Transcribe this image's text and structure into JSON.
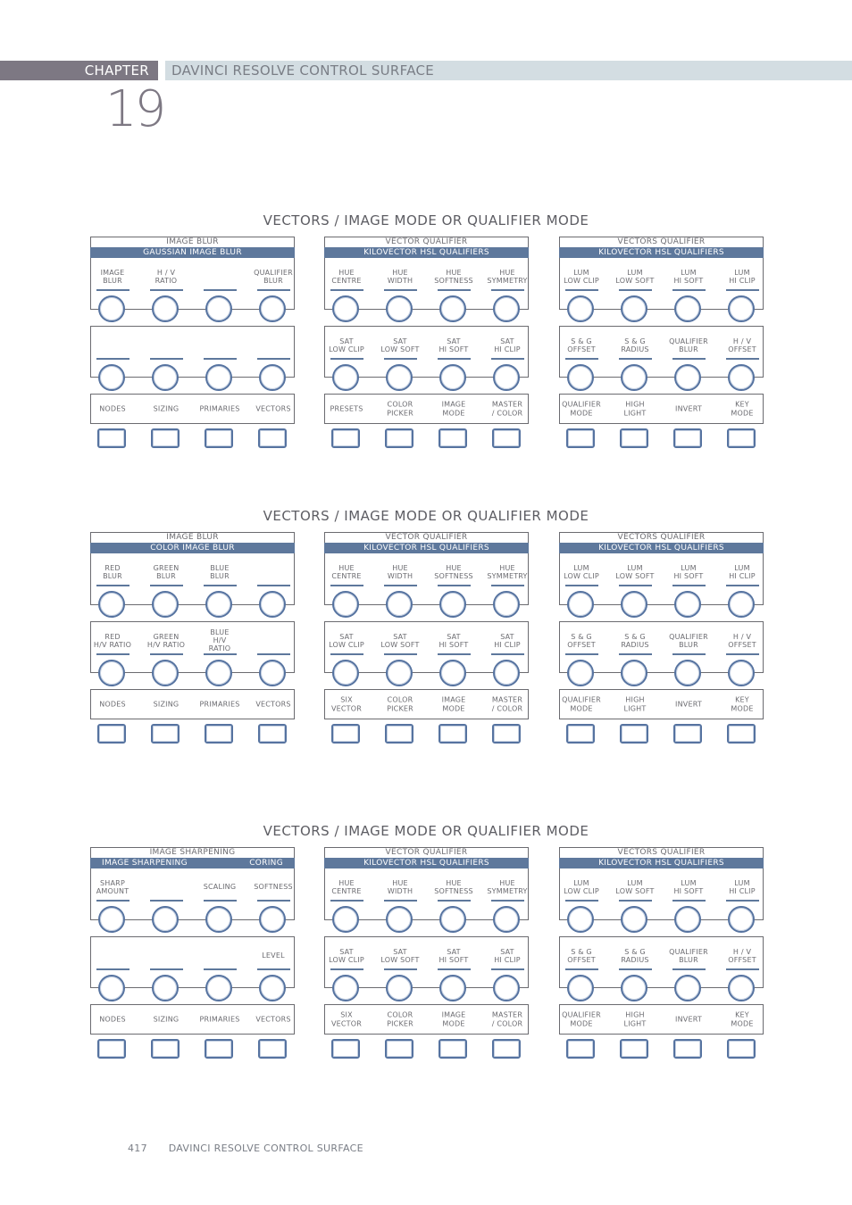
{
  "header": {
    "chapter_label": "CHAPTER",
    "chapter_number": "19",
    "chapter_title": "DAVINCI RESOLVE CONTROL SURFACE"
  },
  "sections": [
    {
      "title": "VECTORS / IMAGE MODE OR QUALIFIER MODE",
      "panels": [
        {
          "header": "IMAGE BLUR",
          "band": [
            "GAUSSIAN IMAGE BLUR"
          ],
          "row1": [
            "IMAGE\nBLUR",
            "H / V\nRATIO",
            "",
            "QUALIFIER\nBLUR"
          ],
          "row2": [
            "",
            "",
            "",
            ""
          ],
          "buttons": [
            "NODES",
            "SIZING",
            "PRIMARIES",
            "VECTORS"
          ]
        },
        {
          "header": "VECTOR QUALIFIER",
          "band": [
            "KILOVECTOR HSL QUALIFIERS"
          ],
          "row1": [
            "HUE\nCENTRE",
            "HUE\nWIDTH",
            "HUE\nSOFTNESS",
            "HUE\nSYMMETRY"
          ],
          "row2": [
            "SAT\nLOW CLIP",
            "SAT\nLOW SOFT",
            "SAT\nHI SOFT",
            "SAT\nHI CLIP"
          ],
          "buttons": [
            "PRESETS",
            "COLOR\nPICKER",
            "IMAGE\nMODE",
            "MASTER\n/ COLOR"
          ]
        },
        {
          "header": "VECTORS QUALIFIER",
          "band": [
            "KILOVECTOR HSL QUALIFIERS"
          ],
          "row1": [
            "LUM\nLOW CLIP",
            "LUM\nLOW SOFT",
            "LUM\nHI SOFT",
            "LUM\nHI CLIP"
          ],
          "row2": [
            "S & G\nOFFSET",
            "S & G\nRADIUS",
            "QUALIFIER\nBLUR",
            "H / V\nOFFSET"
          ],
          "buttons": [
            "QUALIFIER\nMODE",
            "HIGH\nLIGHT",
            "INVERT",
            "KEY\nMODE"
          ]
        }
      ]
    },
    {
      "title": "VECTORS / IMAGE MODE OR QUALIFIER MODE",
      "panels": [
        {
          "header": "IMAGE BLUR",
          "band": [
            "COLOR IMAGE BLUR"
          ],
          "row1": [
            "RED\nBLUR",
            "GREEN\nBLUR",
            "BLUE\nBLUR",
            ""
          ],
          "row2": [
            "RED\nH/V RATIO",
            "GREEN\nH/V RATIO",
            "BLUE\nH/V\nRATIO",
            ""
          ],
          "buttons": [
            "NODES",
            "SIZING",
            "PRIMARIES",
            "VECTORS"
          ]
        },
        {
          "header": "VECTOR QUALIFIER",
          "band": [
            "KILOVECTOR HSL QUALIFIERS"
          ],
          "row1": [
            "HUE\nCENTRE",
            "HUE\nWIDTH",
            "HUE\nSOFTNESS",
            "HUE\nSYMMETRY"
          ],
          "row2": [
            "SAT\nLOW CLIP",
            "SAT\nLOW SOFT",
            "SAT\nHI SOFT",
            "SAT\nHI CLIP"
          ],
          "buttons": [
            "SIX\nVECTOR",
            "COLOR\nPICKER",
            "IMAGE\nMODE",
            "MASTER\n/ COLOR"
          ]
        },
        {
          "header": "VECTORS QUALIFIER",
          "band": [
            "KILOVECTOR HSL QUALIFIERS"
          ],
          "row1": [
            "LUM\nLOW CLIP",
            "LUM\nLOW SOFT",
            "LUM\nHI SOFT",
            "LUM\nHI CLIP"
          ],
          "row2": [
            "S & G\nOFFSET",
            "S & G\nRADIUS",
            "QUALIFIER\nBLUR",
            "H / V\nOFFSET"
          ],
          "buttons": [
            "QUALIFIER\nMODE",
            "HIGH\nLIGHT",
            "INVERT",
            "KEY\nMODE"
          ]
        }
      ]
    },
    {
      "title": "VECTORS / IMAGE MODE OR QUALIFIER MODE",
      "panels": [
        {
          "header": "IMAGE SHARPENING",
          "band": [
            "IMAGE SHARPENING",
            "CORING"
          ],
          "row1": [
            "SHARP\nAMOUNT",
            "",
            "SCALING",
            "SOFTNESS"
          ],
          "row2": [
            "",
            "",
            "",
            "LEVEL"
          ],
          "buttons": [
            "NODES",
            "SIZING",
            "PRIMARIES",
            "VECTORS"
          ]
        },
        {
          "header": "VECTOR QUALIFIER",
          "band": [
            "KILOVECTOR HSL QUALIFIERS"
          ],
          "row1": [
            "HUE\nCENTRE",
            "HUE\nWIDTH",
            "HUE\nSOFTNESS",
            "HUE\nSYMMETRY"
          ],
          "row2": [
            "SAT\nLOW CLIP",
            "SAT\nLOW SOFT",
            "SAT\nHI SOFT",
            "SAT\nHI CLIP"
          ],
          "buttons": [
            "SIX\nVECTOR",
            "COLOR\nPICKER",
            "IMAGE\nMODE",
            "MASTER\n/ COLOR"
          ]
        },
        {
          "header": "VECTORS QUALIFIER",
          "band": [
            "KILOVECTOR HSL QUALIFIERS"
          ],
          "row1": [
            "LUM\nLOW CLIP",
            "LUM\nLOW SOFT",
            "LUM\nHI SOFT",
            "LUM\nHI CLIP"
          ],
          "row2": [
            "S & G\nOFFSET",
            "S & G\nRADIUS",
            "QUALIFIER\nBLUR",
            "H / V\nOFFSET"
          ],
          "buttons": [
            "QUALIFIER\nMODE",
            "HIGH\nLIGHT",
            "INVERT",
            "KEY\nMODE"
          ]
        }
      ]
    }
  ],
  "footer": {
    "page_number": "417",
    "text": "DAVINCI RESOLVE CONTROL SURFACE"
  },
  "colors": {
    "accent_band": "#5e789c",
    "chapter_tab": "#7d7883",
    "title_bar": "#d3dde2"
  }
}
